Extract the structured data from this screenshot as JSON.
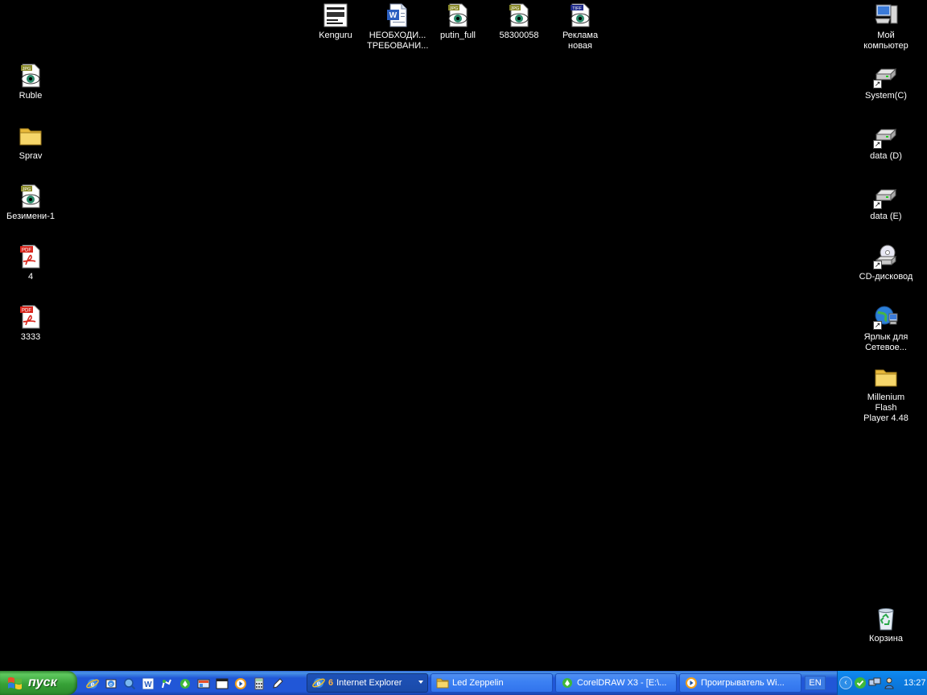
{
  "desktop_icons": {
    "kenguru": {
      "label": "Kenguru",
      "icon": "image-thumbnail-icon"
    },
    "neobhodimye": {
      "label": "НЕОБХОДИ...\nТРЕБОВАНИ...",
      "icon": "word-document-icon"
    },
    "putin_full": {
      "label": "putin_full",
      "icon": "jpg-file-icon"
    },
    "n58300058": {
      "label": "58300058",
      "icon": "jpg-file-icon"
    },
    "reklama": {
      "label": "Реклама\nновая",
      "icon": "tiff-file-icon"
    },
    "my_computer": {
      "label": "Мой\nкомпьютер",
      "icon": "my-computer-icon"
    },
    "ruble": {
      "label": "Ruble",
      "icon": "jpg-file-icon"
    },
    "system_c": {
      "label": "System(C)",
      "icon": "drive-shortcut-icon"
    },
    "sprav": {
      "label": "Sprav",
      "icon": "folder-icon"
    },
    "data_d": {
      "label": "data (D)",
      "icon": "drive-shortcut-icon"
    },
    "bezimeni": {
      "label": "Безимени-1",
      "icon": "jpg-file-icon"
    },
    "data_e": {
      "label": "data (E)",
      "icon": "drive-shortcut-icon"
    },
    "pdf4": {
      "label": "4",
      "icon": "pdf-file-icon"
    },
    "cd": {
      "label": "CD-дисковод",
      "icon": "cd-drive-shortcut-icon"
    },
    "pdf3333": {
      "label": "3333",
      "icon": "pdf-file-icon"
    },
    "network": {
      "label": "Ярлык для\nСетевое...",
      "icon": "network-shortcut-icon"
    },
    "millenium": {
      "label": "Millenium Flash\nPlayer 4.48",
      "icon": "folder-icon"
    },
    "recycle": {
      "label": "Корзина",
      "icon": "recycle-bin-icon"
    }
  },
  "taskbar": {
    "start_label": "пуск",
    "tasks": [
      {
        "count": "6",
        "label": "Internet Explorer",
        "icon": "internet-explorer-icon"
      },
      {
        "label": "Led Zeppelin",
        "icon": "folder-icon"
      },
      {
        "label": "CorelDRAW X3 - [E:\\...",
        "icon": "coreldraw-icon"
      },
      {
        "label": "Проигрыватель Wi...",
        "icon": "media-player-icon"
      }
    ],
    "language": "EN",
    "clock": "13:27"
  },
  "colors": {
    "desktop_bg": "#000000",
    "taskbar_blue": "#2157d7",
    "start_green": "#37a137",
    "tray_blue": "#0c7fe5"
  }
}
